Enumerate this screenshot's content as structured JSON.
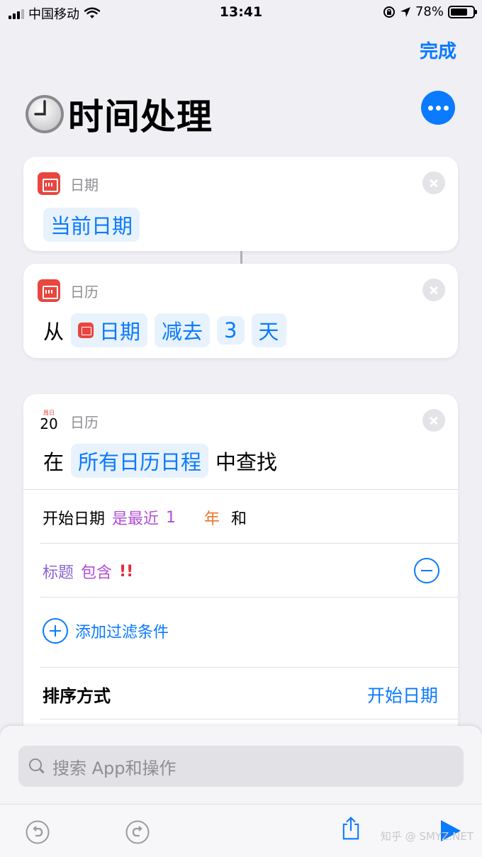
{
  "status_bar": {
    "carrier": "中国移动",
    "time": "13:41",
    "battery": "78%",
    "battery_level": 0.78
  },
  "header": {
    "done_label": "完成",
    "title": "时间处理",
    "title_icon": "clock-emoji"
  },
  "actions": [
    {
      "label": "日期",
      "token": "当前日期"
    },
    {
      "label": "日历",
      "prefix": "从",
      "date_token": "日期",
      "op_token": "减去",
      "amount_token": "3",
      "unit_token": "天"
    },
    {
      "label": "日历",
      "date_icon_dow": "周日",
      "date_icon_day": "20",
      "prefix": "在",
      "token": "所有日历日程",
      "suffix": "中查找",
      "filters": {
        "row1_key": "开始日期",
        "row1_op": "是最近",
        "row1_value": "1",
        "row1_unit": "年",
        "row1_conj": "和",
        "row2_key": "标题",
        "row2_op": "包含",
        "row2_value": "!!",
        "add_label": "添加过滤条件"
      },
      "sort": {
        "label": "排序方式",
        "value": "开始日期"
      }
    }
  ],
  "bottom": {
    "search_placeholder": "搜索 App和操作",
    "watermark": "知乎 @ SMYZ.NET"
  },
  "colors": {
    "accent": "#0a7aff",
    "calendar_red": "#e8463f",
    "background": "#efeff4"
  }
}
